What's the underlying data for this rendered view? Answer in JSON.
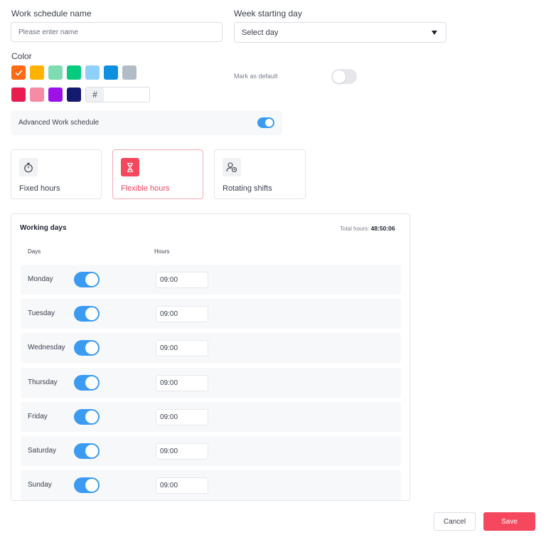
{
  "form": {
    "name_label": "Work schedule name",
    "name_placeholder": "Please enter name",
    "week_label": "Week starting day",
    "week_value": "Select day",
    "color_label": "Color",
    "hash_symbol": "#",
    "mark_default_label": "Mark as default",
    "advanced_label": "Advanced Work schedule"
  },
  "colors": {
    "row1": [
      "#ff6a13",
      "#ffb300",
      "#7fdbb2",
      "#05cb7e",
      "#8ed2fb",
      "#0f8fe0",
      "#b2bcc6"
    ],
    "row2": [
      "#e81c4f",
      "#f58ba4",
      "#9b11e8",
      "#141a6e"
    ],
    "selected_index": 0,
    "accent": "#3b9bf2",
    "brand": "#f5475e"
  },
  "schedule_types": [
    {
      "label": "Fixed hours",
      "icon": "stopwatch-icon",
      "selected": false
    },
    {
      "label": "Flexible hours",
      "icon": "hourglass-icon",
      "selected": true
    },
    {
      "label": "Rotating shifts",
      "icon": "user-clock-icon",
      "selected": false
    }
  ],
  "working_days": {
    "title": "Working days",
    "total_label": "Total hours:",
    "total_value": "48:50:06",
    "col_days": "Days",
    "col_hours": "Hours",
    "rows": [
      {
        "day": "Monday",
        "enabled": true,
        "hours": "09:00"
      },
      {
        "day": "Tuesday",
        "enabled": true,
        "hours": "09:00"
      },
      {
        "day": "Wednesday",
        "enabled": true,
        "hours": "09:00"
      },
      {
        "day": "Thursday",
        "enabled": true,
        "hours": "09:00"
      },
      {
        "day": "Friday",
        "enabled": true,
        "hours": "09:00"
      },
      {
        "day": "Saturday",
        "enabled": true,
        "hours": "09:00"
      },
      {
        "day": "Sunday",
        "enabled": true,
        "hours": "09:00"
      }
    ]
  },
  "actions": {
    "cancel": "Cancel",
    "save": "Save"
  },
  "toggles": {
    "mark_default": false,
    "advanced": true
  }
}
